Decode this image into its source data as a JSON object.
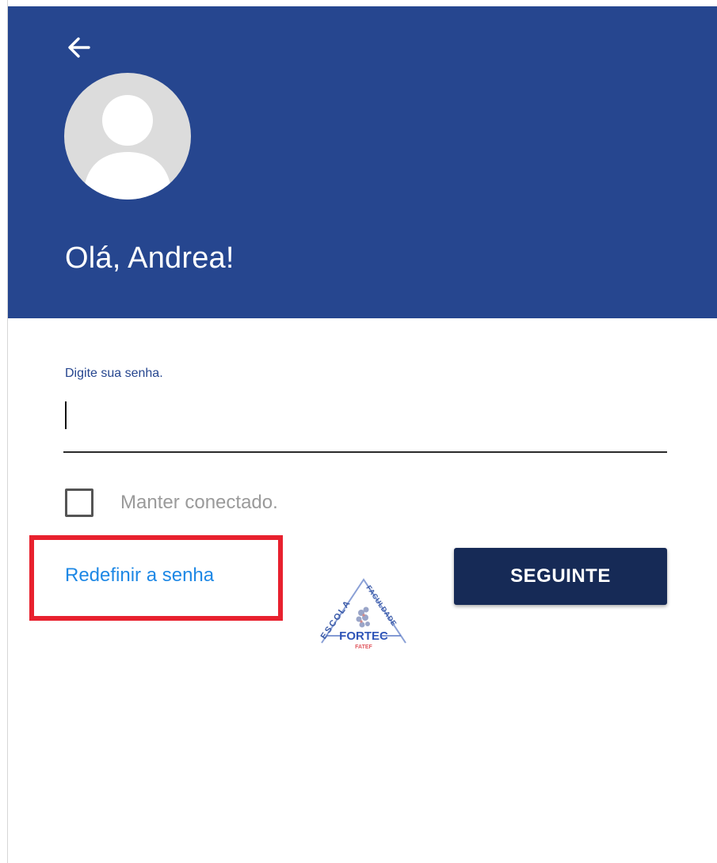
{
  "header": {
    "greeting": "Olá, Andrea!",
    "background_color": "#26468f",
    "back_icon": "arrow-left-icon",
    "avatar_icon": "user-avatar-icon"
  },
  "form": {
    "password_label": "Digite sua senha.",
    "password_value": "",
    "keep_connected_label": "Manter conectado.",
    "keep_connected_checked": false,
    "reset_password_link": "Redefinir a senha",
    "next_button_label": "SEGUINTE",
    "next_button_color": "#162a56",
    "link_color": "#1e88e5",
    "highlight_color": "#e8212e"
  },
  "footer": {
    "logo_name": "FORTEC",
    "logo_arc_left": "ESCOLA",
    "logo_arc_right": "FACULDADE",
    "logo_subtext": "FATEF"
  }
}
